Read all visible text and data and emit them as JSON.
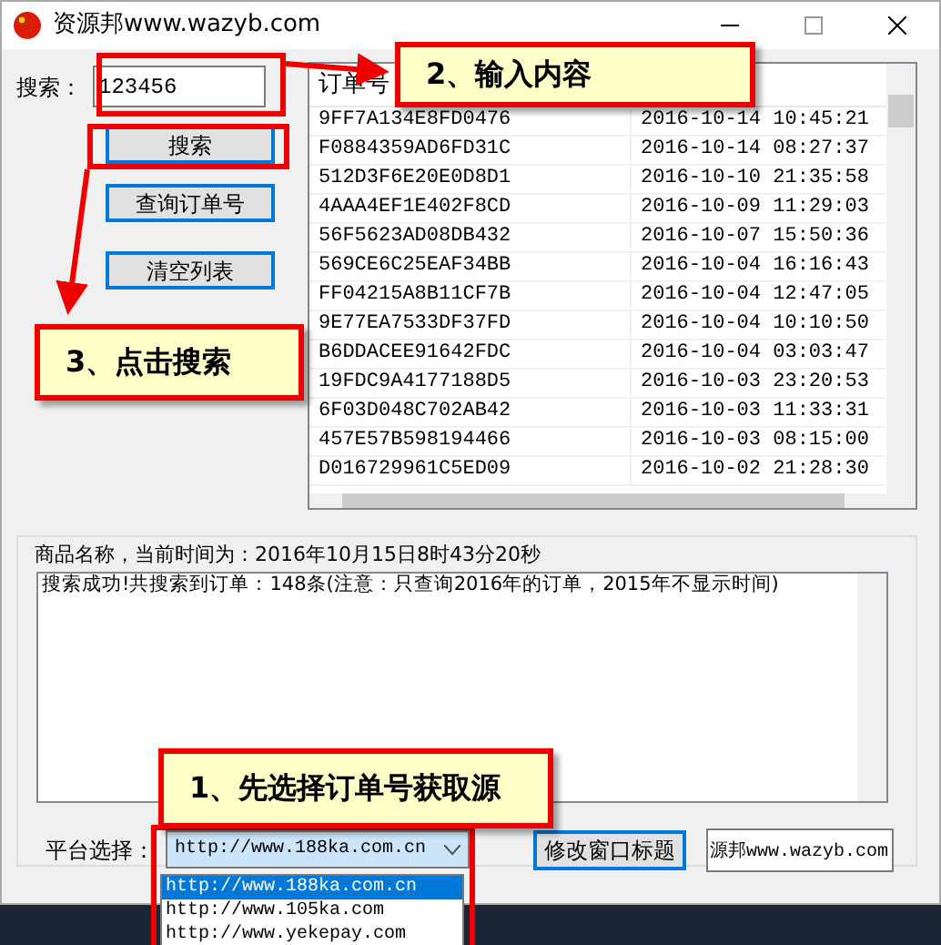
{
  "window": {
    "title": "资源邦www.wazyb.com"
  },
  "search": {
    "label": "搜索：",
    "value": "123456"
  },
  "buttons": [
    {
      "label": "搜索",
      "focused": true
    },
    {
      "label": "查询订单号",
      "focused": true
    },
    {
      "label": "清空列表",
      "focused": true
    }
  ],
  "order_list": {
    "columns": [
      "订单号"
    ],
    "rows": [
      {
        "order": "9FF7A134E8FD0476",
        "time": "2016-10-14 10:45:21"
      },
      {
        "order": "F0884359AD6FD31C",
        "time": "2016-10-14 08:27:37"
      },
      {
        "order": "512D3F6E20E0D8D1",
        "time": "2016-10-10 21:35:58"
      },
      {
        "order": "4AAA4EF1E402F8CD",
        "time": "2016-10-09 11:29:03"
      },
      {
        "order": "56F5623AD08DB432",
        "time": "2016-10-07 15:50:36"
      },
      {
        "order": "569CE6C25EAF34BB",
        "time": "2016-10-04 16:16:43"
      },
      {
        "order": "FF04215A8B11CF7B",
        "time": "2016-10-04 12:47:05"
      },
      {
        "order": "9E77EA7533DF37FD",
        "time": "2016-10-04 10:10:50"
      },
      {
        "order": "B6DDACEE91642FDC",
        "time": "2016-10-04 03:03:47"
      },
      {
        "order": "19FDC9A4177188D5",
        "time": "2016-10-03 23:20:53"
      },
      {
        "order": "6F03D048C702AB42",
        "time": "2016-10-03 11:33:31"
      },
      {
        "order": "457E57B598194466",
        "time": "2016-10-03 08:15:00"
      },
      {
        "order": "D016729961C5ED09",
        "time": "2016-10-02 21:28:30"
      }
    ]
  },
  "group": {
    "title": "商品名称，当前时间为：2016年10月15日8时43分20秒",
    "log": "搜索成功!共搜索到订单：148条(注意：只查询2016年的订单，2015年不显示时间)"
  },
  "platform": {
    "label": "平台选择：",
    "value": "http://www.188ka.com.cn",
    "expanded": true,
    "options": [
      {
        "label": "http://www.188ka.com.cn",
        "selected": true
      },
      {
        "label": "http://www.105ka.com",
        "selected": false
      },
      {
        "label": "http://www.yekepay.com",
        "selected": false
      }
    ]
  },
  "rename_button": {
    "label": "修改窗口标题",
    "focused": true
  },
  "title_field": {
    "value": "源邦www.wazyb.com"
  },
  "callouts": [
    {
      "text": "2、输入内容"
    },
    {
      "text": "3、点击搜索"
    },
    {
      "text": "1、先选择订单号获取源"
    }
  ]
}
